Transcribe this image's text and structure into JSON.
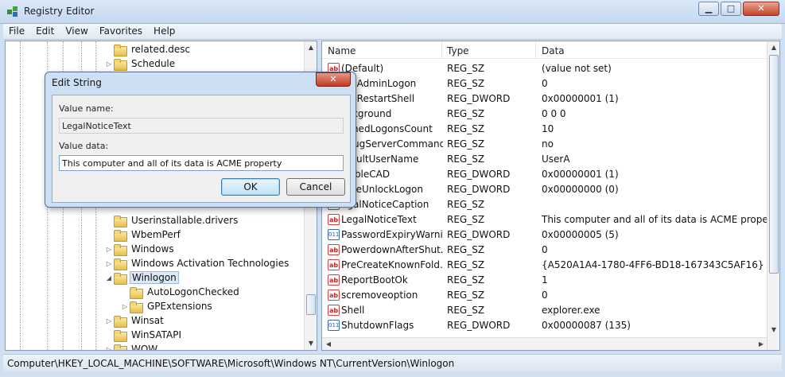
{
  "window": {
    "title": "Registry Editor",
    "controls": {
      "minimize": "▁",
      "maximize": "□",
      "close": "✕"
    }
  },
  "menu": [
    "File",
    "Edit",
    "View",
    "Favorites",
    "Help"
  ],
  "tree": {
    "items": [
      {
        "label": "related.desc",
        "arrow": ""
      },
      {
        "label": "Schedule",
        "arrow": "▷"
      },
      {
        "label": "Userinstallable.drivers",
        "arrow": ""
      },
      {
        "label": "WbemPerf",
        "arrow": ""
      },
      {
        "label": "Windows",
        "arrow": "▷"
      },
      {
        "label": "Windows Activation Technologies",
        "arrow": "▷"
      },
      {
        "label": "Winlogon",
        "arrow": "◢"
      },
      {
        "label": "AutoLogonChecked",
        "arrow": ""
      },
      {
        "label": "GPExtensions",
        "arrow": "▷"
      },
      {
        "label": "Winsat",
        "arrow": "▷"
      },
      {
        "label": "WinSATAPI",
        "arrow": ""
      },
      {
        "label": "WOW",
        "arrow": "▷"
      }
    ]
  },
  "list": {
    "columns": [
      "Name",
      "Type",
      "Data"
    ],
    "rows": [
      {
        "icon": "ab",
        "name": "(Default)",
        "type": "REG_SZ",
        "data": "(value not set)"
      },
      {
        "icon": "ab",
        "name": "utoAdminLogon",
        "type": "REG_SZ",
        "data": "0"
      },
      {
        "icon": "bin",
        "name": "utoRestartShell",
        "type": "REG_DWORD",
        "data": "0x00000001 (1)"
      },
      {
        "icon": "ab",
        "name": "ackground",
        "type": "REG_SZ",
        "data": "0 0 0"
      },
      {
        "icon": "ab",
        "name": "achedLogonsCount",
        "type": "REG_SZ",
        "data": "10"
      },
      {
        "icon": "ab",
        "name": "ebugServerCommand",
        "type": "REG_SZ",
        "data": "no"
      },
      {
        "icon": "ab",
        "name": "efaultUserName",
        "type": "REG_SZ",
        "data": "UserA"
      },
      {
        "icon": "bin",
        "name": "isableCAD",
        "type": "REG_DWORD",
        "data": "0x00000001 (1)"
      },
      {
        "icon": "bin",
        "name": "orceUnlockLogon",
        "type": "REG_DWORD",
        "data": "0x00000000 (0)"
      },
      {
        "icon": "ab",
        "name": "egalNoticeCaption",
        "type": "REG_SZ",
        "data": ""
      },
      {
        "icon": "ab",
        "name": "LegalNoticeText",
        "type": "REG_SZ",
        "data": "This computer and all of its data is ACME property"
      },
      {
        "icon": "bin",
        "name": "PasswordExpiryWarni...",
        "type": "REG_DWORD",
        "data": "0x00000005 (5)"
      },
      {
        "icon": "ab",
        "name": "PowerdownAfterShut...",
        "type": "REG_SZ",
        "data": "0"
      },
      {
        "icon": "ab",
        "name": "PreCreateKnownFold...",
        "type": "REG_SZ",
        "data": "{A520A1A4-1780-4FF6-BD18-167343C5AF16}"
      },
      {
        "icon": "ab",
        "name": "ReportBootOk",
        "type": "REG_SZ",
        "data": "1"
      },
      {
        "icon": "ab",
        "name": "scremoveoption",
        "type": "REG_SZ",
        "data": "0"
      },
      {
        "icon": "ab",
        "name": "Shell",
        "type": "REG_SZ",
        "data": "explorer.exe"
      },
      {
        "icon": "bin",
        "name": "ShutdownFlags",
        "type": "REG_DWORD",
        "data": "0x00000087 (135)"
      }
    ]
  },
  "status": "Computer\\HKEY_LOCAL_MACHINE\\SOFTWARE\\Microsoft\\Windows NT\\CurrentVersion\\Winlogon",
  "dialog": {
    "title": "Edit String",
    "close": "✕",
    "value_name_label": "Value name:",
    "value_name": "LegalNoticeText",
    "value_data_label": "Value data:",
    "value_data": "This computer and all of its data is ACME property",
    "ok": "OK",
    "cancel": "Cancel"
  }
}
